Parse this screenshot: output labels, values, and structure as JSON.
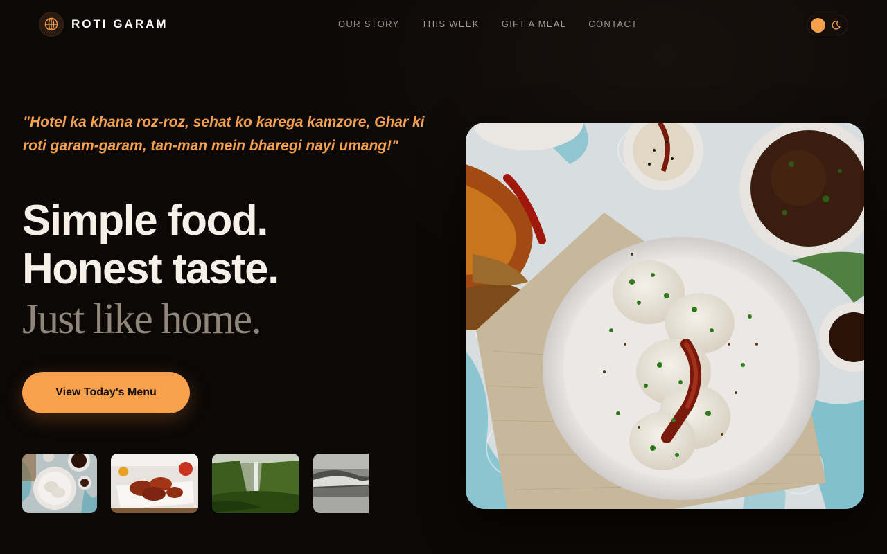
{
  "brand": {
    "name": "ROTI GARAM",
    "icon": "globe-icon"
  },
  "nav": [
    {
      "label": "OUR STORY"
    },
    {
      "label": "THIS WEEK"
    },
    {
      "label": "GIFT A MEAL"
    },
    {
      "label": "CONTACT"
    }
  ],
  "theme_toggle": {
    "icons": [
      "sun-knob",
      "moon-icon"
    ]
  },
  "hero": {
    "quote": "\"Hotel ka khana roz-roz, sehat ko karega kamzore, Ghar ki roti garam-garam, tan-man mein bharegi nayi umang!\"",
    "headline_1": "Simple food.",
    "headline_2": "Honest taste.",
    "headline_3": "Just like home.",
    "cta_label": "View Today's Menu"
  },
  "thumbnails": [
    "idli-plate",
    "fried-chicken",
    "waterfall",
    "ocean-wave"
  ],
  "colors": {
    "accent": "#f8a04c",
    "background": "#0b0806",
    "headline": "#f6f0e8",
    "subhead": "#908679",
    "nav": "#a39a92"
  }
}
